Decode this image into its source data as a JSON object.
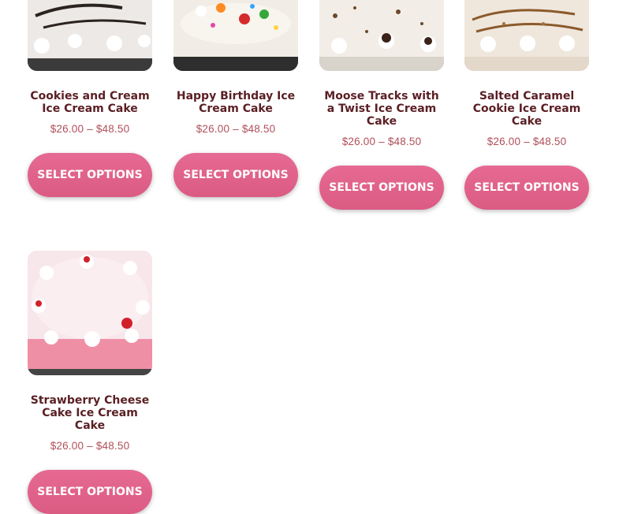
{
  "products": [
    {
      "title": "Cookies and Cream Ice Cream Cake",
      "price_low": "$26.00",
      "price_sep": "–",
      "price_high": "$48.50",
      "button": "SELECT OPTIONS"
    },
    {
      "title": "Happy Birthday Ice Cream Cake",
      "price_low": "$26.00",
      "price_sep": "–",
      "price_high": "$48.50",
      "button": "SELECT OPTIONS"
    },
    {
      "title": "Moose Tracks with a Twist Ice Cream Cake",
      "price_low": "$26.00",
      "price_sep": "–",
      "price_high": "$48.50",
      "button": "SELECT OPTIONS"
    },
    {
      "title": "Salted Caramel Cookie Ice Cream Cake",
      "price_low": "$26.00",
      "price_sep": "–",
      "price_high": "$48.50",
      "button": "SELECT OPTIONS"
    },
    {
      "title": "Strawberry Cheese Cake Ice Cream Cake",
      "price_low": "$26.00",
      "price_sep": "–",
      "price_high": "$48.50",
      "button": "SELECT OPTIONS"
    }
  ],
  "colors": {
    "accent": "#e06389",
    "title": "#5a1f24",
    "price": "#b04f59"
  }
}
